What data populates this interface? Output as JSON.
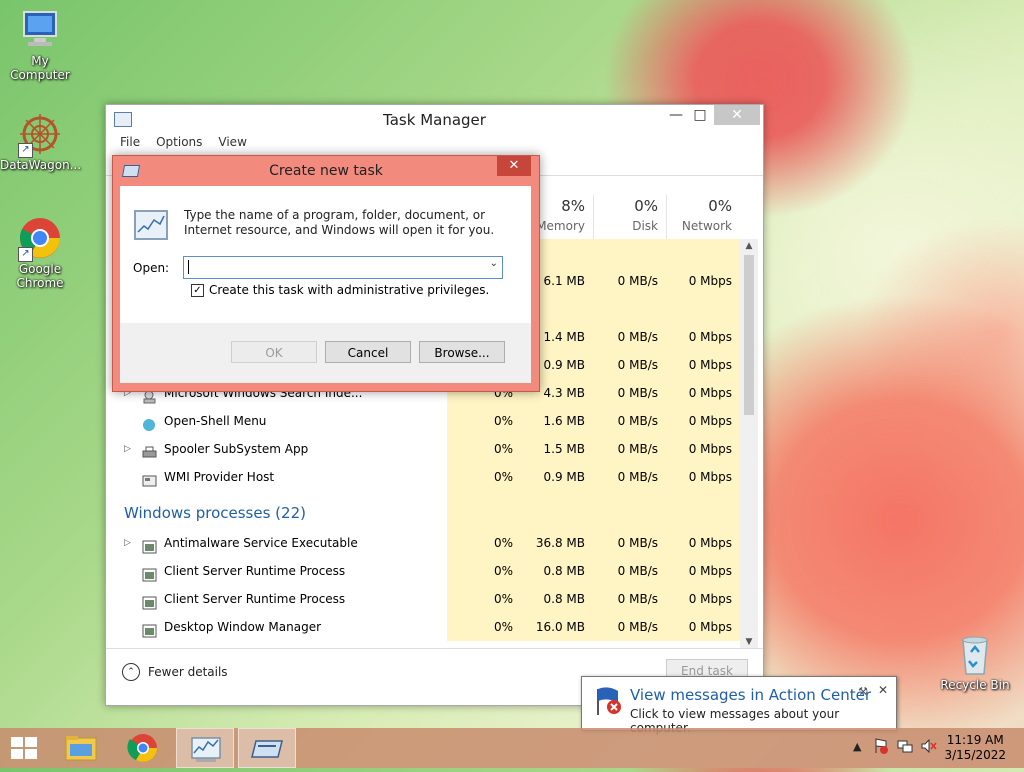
{
  "desktop": {
    "icons": [
      {
        "label": "My Computer",
        "icon": "computer-icon"
      },
      {
        "label": "DataWagon...",
        "icon": "datawagon-icon"
      },
      {
        "label": "Google Chrome",
        "icon": "chrome-icon"
      },
      {
        "label": "Recycle Bin",
        "icon": "recycle-bin-icon"
      }
    ]
  },
  "task_manager": {
    "title": "Task Manager",
    "menu": [
      "File",
      "Options",
      "View"
    ],
    "columns": [
      {
        "pct": "8%",
        "label": "Memory"
      },
      {
        "pct": "0%",
        "label": "Disk"
      },
      {
        "pct": "0%",
        "label": "Network"
      }
    ],
    "rows": [
      {
        "name": "",
        "cpu": "",
        "mem": "",
        "disk": "",
        "net": ""
      },
      {
        "name": "",
        "cpu": "",
        "mem": "6.1 MB",
        "disk": "0 MB/s",
        "net": "0 Mbps"
      },
      {
        "name": "",
        "cpu": "",
        "mem": "",
        "disk": "",
        "net": ""
      },
      {
        "name": "",
        "cpu": "",
        "mem": "1.4 MB",
        "disk": "0 MB/s",
        "net": "0 Mbps"
      },
      {
        "name": "",
        "cpu": "",
        "mem": "0.9 MB",
        "disk": "0 MB/s",
        "net": "0 Mbps"
      },
      {
        "name": "Microsoft Windows Search Inde...",
        "cpu": "0%",
        "mem": "4.3 MB",
        "disk": "0 MB/s",
        "net": "0 Mbps",
        "expand": true
      },
      {
        "name": "Open-Shell Menu",
        "cpu": "0%",
        "mem": "1.6 MB",
        "disk": "0 MB/s",
        "net": "0 Mbps"
      },
      {
        "name": "Spooler SubSystem App",
        "cpu": "0%",
        "mem": "1.5 MB",
        "disk": "0 MB/s",
        "net": "0 Mbps",
        "expand": true
      },
      {
        "name": "WMI Provider Host",
        "cpu": "0%",
        "mem": "0.9 MB",
        "disk": "0 MB/s",
        "net": "0 Mbps"
      }
    ],
    "group": "Windows processes (22)",
    "win_rows": [
      {
        "name": "Antimalware Service Executable",
        "cpu": "0%",
        "mem": "36.8 MB",
        "disk": "0 MB/s",
        "net": "0 Mbps",
        "expand": true
      },
      {
        "name": "Client Server Runtime Process",
        "cpu": "0%",
        "mem": "0.8 MB",
        "disk": "0 MB/s",
        "net": "0 Mbps"
      },
      {
        "name": "Client Server Runtime Process",
        "cpu": "0%",
        "mem": "0.8 MB",
        "disk": "0 MB/s",
        "net": "0 Mbps"
      },
      {
        "name": "Desktop Window Manager",
        "cpu": "0%",
        "mem": "16.0 MB",
        "disk": "0 MB/s",
        "net": "0 Mbps"
      }
    ],
    "fewer_details": "Fewer details",
    "end_task": "End task"
  },
  "dialog": {
    "title": "Create new task",
    "message": "Type the name of a program, folder, document, or Internet resource, and Windows will open it for you.",
    "open_label": "Open:",
    "open_value": "",
    "admin_checkbox": "Create this task with administrative privileges.",
    "admin_checked": true,
    "ok": "OK",
    "cancel": "Cancel",
    "browse": "Browse..."
  },
  "notification": {
    "title": "View messages in Action Center",
    "body": "Click to view messages about your computer."
  },
  "taskbar": {
    "time": "11:19 AM",
    "date": "3/15/2022"
  }
}
